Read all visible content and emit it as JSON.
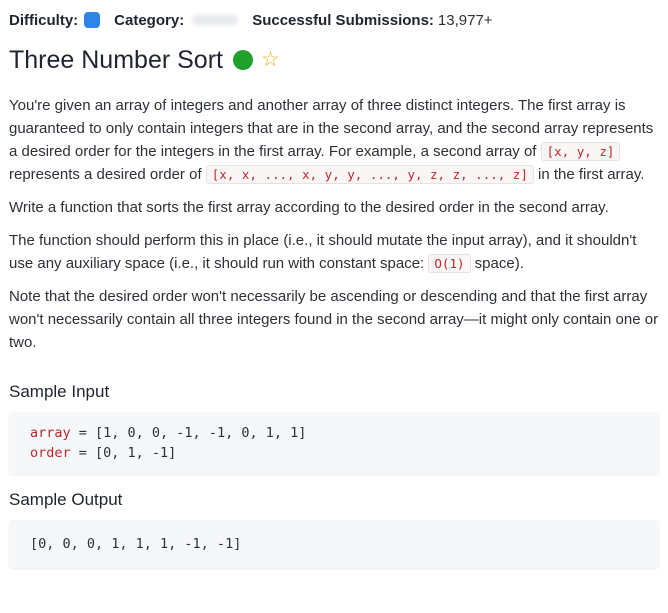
{
  "meta": {
    "difficulty_label": "Difficulty:",
    "category_label": "Category:",
    "submissions_label": "Successful Submissions:",
    "submissions_value": "13,977+",
    "difficulty_color": "#2e86e8"
  },
  "problem": {
    "title": "Three Number Sort",
    "status_color": "#1fa12b",
    "star_icon": "☆"
  },
  "description": {
    "p1_a": "You're given an array of integers and another array of three distinct integers. The first array is guaranteed to only contain integers that are in the second array, and the second array represents a desired order for the integers in the first array. For example, a second array of ",
    "p1_code1": "[x, y, z]",
    "p1_b": " represents a desired order of ",
    "p1_code2": "[x, x, ..., x, y, y, ..., y, z, z, ..., z]",
    "p1_c": " in the first array.",
    "p2": "Write a function that sorts the first array according to the desired order in the second array.",
    "p3_a": "The function should perform this in place (i.e., it should mutate the input array), and it shouldn't use any auxiliary space (i.e., it should run with constant space: ",
    "p3_code": "O(1)",
    "p3_b": " space).",
    "p4": "Note that the desired order won't necessarily be ascending or descending and that the first array won't necessarily contain all three integers found in the second array—it might only contain one or two."
  },
  "sample_input": {
    "title": "Sample Input",
    "line1_var": "array",
    "line1_rest": " = [1, 0, 0, -1, -1, 0, 1, 1]",
    "line2_var": "order",
    "line2_rest": " = [0, 1, -1]"
  },
  "sample_output": {
    "title": "Sample Output",
    "value": "[0, 0, 0, 1, 1, 1, -1, -1]"
  }
}
